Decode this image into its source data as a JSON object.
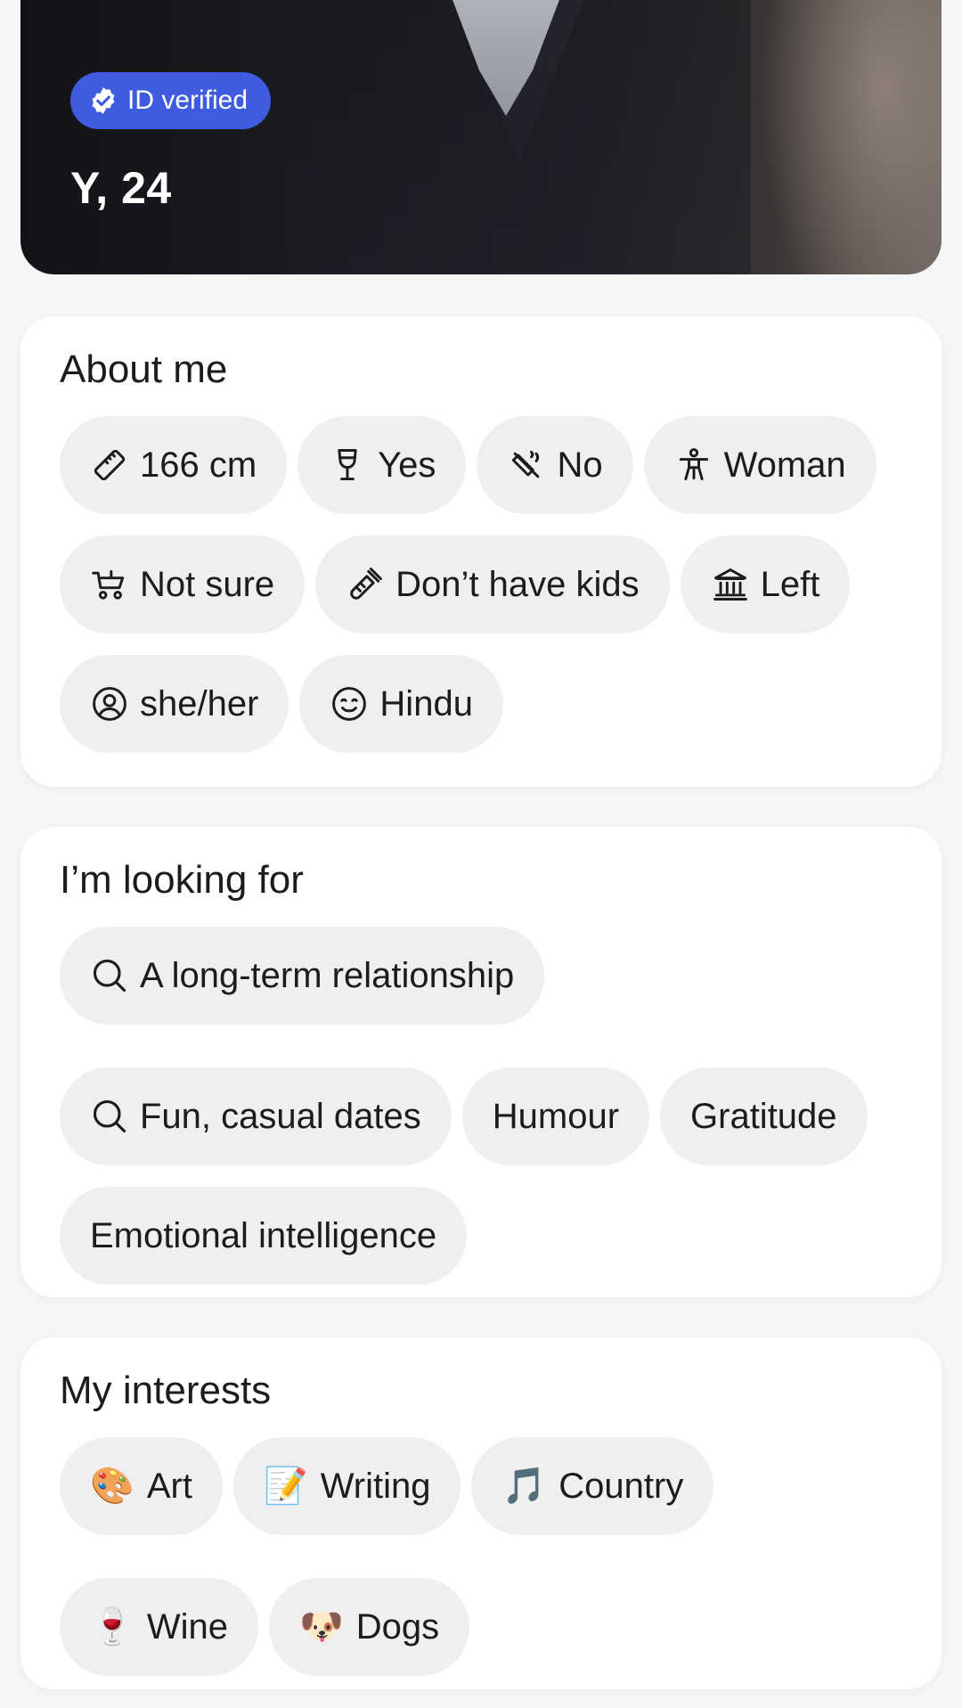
{
  "profile": {
    "verified_label": "ID verified",
    "name_age": "Y, 24",
    "badge_color": "#3f5ce0"
  },
  "about": {
    "title": "About me",
    "chips": [
      {
        "label": "166 cm",
        "icon": "ruler-icon"
      },
      {
        "label": "Yes",
        "icon": "wine-glass-icon"
      },
      {
        "label": "No",
        "icon": "no-smoking-icon"
      },
      {
        "label": "Woman",
        "icon": "person-icon"
      },
      {
        "label": "Not sure",
        "icon": "stroller-icon"
      },
      {
        "label": "Don’t have kids",
        "icon": "baby-bottle-icon"
      },
      {
        "label": "Left",
        "icon": "government-building-icon"
      },
      {
        "label": "she/her",
        "icon": "user-circle-icon"
      },
      {
        "label": "Hindu",
        "icon": "smile-face-icon"
      }
    ]
  },
  "looking_for": {
    "title": "I’m looking for",
    "chips": [
      {
        "label": "A long-term relationship",
        "icon": "search-icon"
      },
      {
        "label": "Fun, casual dates",
        "icon": "search-icon"
      },
      {
        "label": "Humour"
      },
      {
        "label": "Gratitude"
      },
      {
        "label": "Emotional intelligence"
      }
    ]
  },
  "interests": {
    "title": "My interests",
    "chips": [
      {
        "label": "Art",
        "emoji": "🎨"
      },
      {
        "label": "Writing",
        "emoji": "📝"
      },
      {
        "label": "Country",
        "emoji": "🎵"
      },
      {
        "label": "Wine",
        "emoji": "🍷"
      },
      {
        "label": "Dogs",
        "emoji": "🐶"
      }
    ]
  }
}
